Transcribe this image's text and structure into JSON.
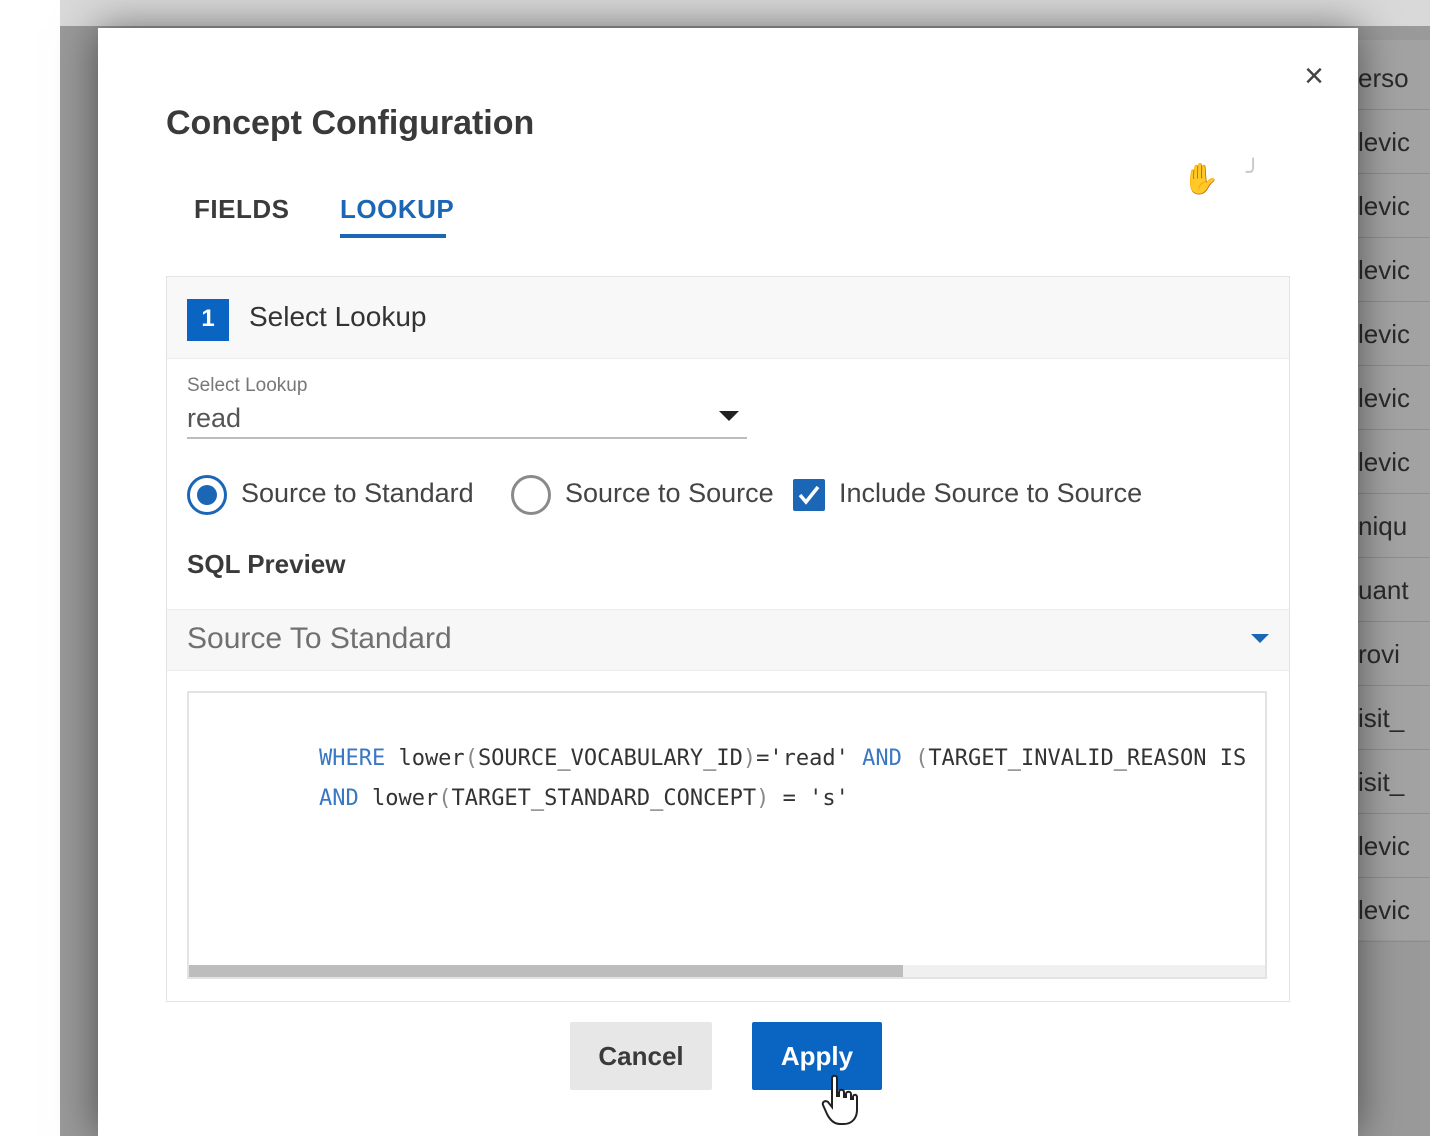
{
  "background": {
    "items": [
      "erso",
      "levic",
      "levic",
      "levic",
      "levic",
      "levic",
      "levic",
      "niqu",
      "uant",
      "rovi",
      "isit_",
      "isit_",
      "levic",
      "levic"
    ]
  },
  "dialog": {
    "title": "Concept Configuration",
    "close_icon": "×",
    "tabs": [
      {
        "label": "FIELDS",
        "active": false
      },
      {
        "label": "LOOKUP",
        "active": true
      }
    ],
    "step": {
      "number": "1",
      "label": "Select Lookup"
    },
    "lookup": {
      "field_label": "Select Lookup",
      "value": "read"
    },
    "options": {
      "radio_1": {
        "label": "Source to Standard",
        "checked": true
      },
      "radio_2": {
        "label": "Source to Source",
        "checked": false
      },
      "checkbox": {
        "label": "Include Source to Source",
        "checked": true
      }
    },
    "sql_preview": {
      "title": "SQL Preview",
      "selected": "Source To Standard",
      "lines": [
        [
          "WHERE",
          " lower",
          "(",
          "SOURCE_VOCABULARY_ID",
          ")",
          "=",
          "'read'",
          " AND ",
          "(",
          "TARGET_INVALID_REASON IS"
        ],
        [
          "AND",
          " lower",
          "(",
          "TARGET_STANDARD_CONCEPT",
          ")",
          " = ",
          "'s'"
        ]
      ]
    },
    "buttons": {
      "cancel": "Cancel",
      "apply": "Apply"
    }
  },
  "colors": {
    "accent": "#1b67b6",
    "primary_button": "#0a64c2",
    "keyword": "#3a78c4"
  },
  "icons": {
    "close": "close-icon",
    "caret": "chevron-down-icon",
    "check": "check-icon",
    "cursor": "hand-pointer-icon"
  }
}
